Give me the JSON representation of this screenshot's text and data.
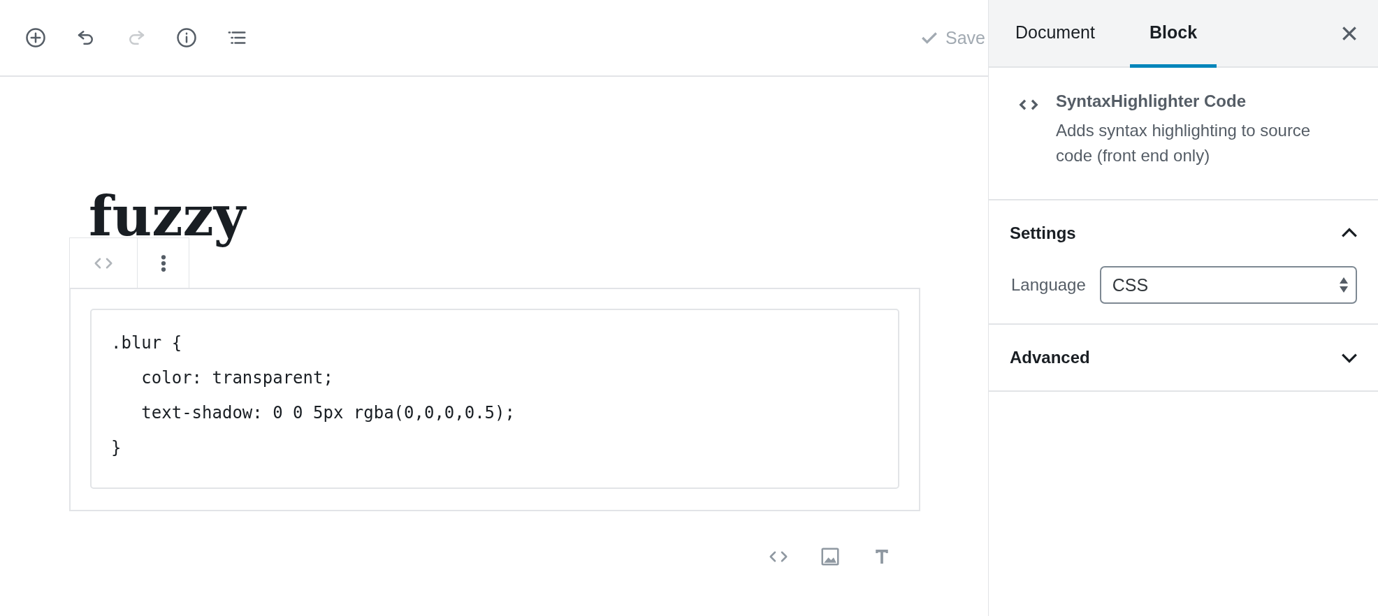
{
  "toolbar": {
    "tools": [
      {
        "kind": "add",
        "disabled": false
      },
      {
        "kind": "undo",
        "disabled": false
      },
      {
        "kind": "redo",
        "disabled": true
      },
      {
        "kind": "info",
        "disabled": false
      },
      {
        "kind": "outline",
        "disabled": false
      }
    ],
    "save_label": "Save"
  },
  "post": {
    "title": "fuzzy",
    "block_toolbar": [
      {
        "kind": "code"
      },
      {
        "kind": "more"
      }
    ],
    "code_lines": [
      ".blur {",
      "   color: transparent;",
      "   text-shadow: 0 0 5px rgba(0,0,0,0.5);",
      "}"
    ],
    "inserter": [
      {
        "kind": "code"
      },
      {
        "kind": "image"
      },
      {
        "kind": "text"
      }
    ]
  },
  "sidebar": {
    "tabs": [
      {
        "label": "Document",
        "selected": false
      },
      {
        "label": "Block",
        "selected": true
      }
    ],
    "block_card": {
      "title": "SyntaxHighlighter Code",
      "description": "Adds syntax highlighting to source code (front end only)"
    },
    "panels": [
      {
        "title": "Settings",
        "expanded": true,
        "fields": [
          {
            "label": "Language",
            "value": "CSS"
          }
        ]
      },
      {
        "title": "Advanced",
        "expanded": false
      }
    ]
  }
}
